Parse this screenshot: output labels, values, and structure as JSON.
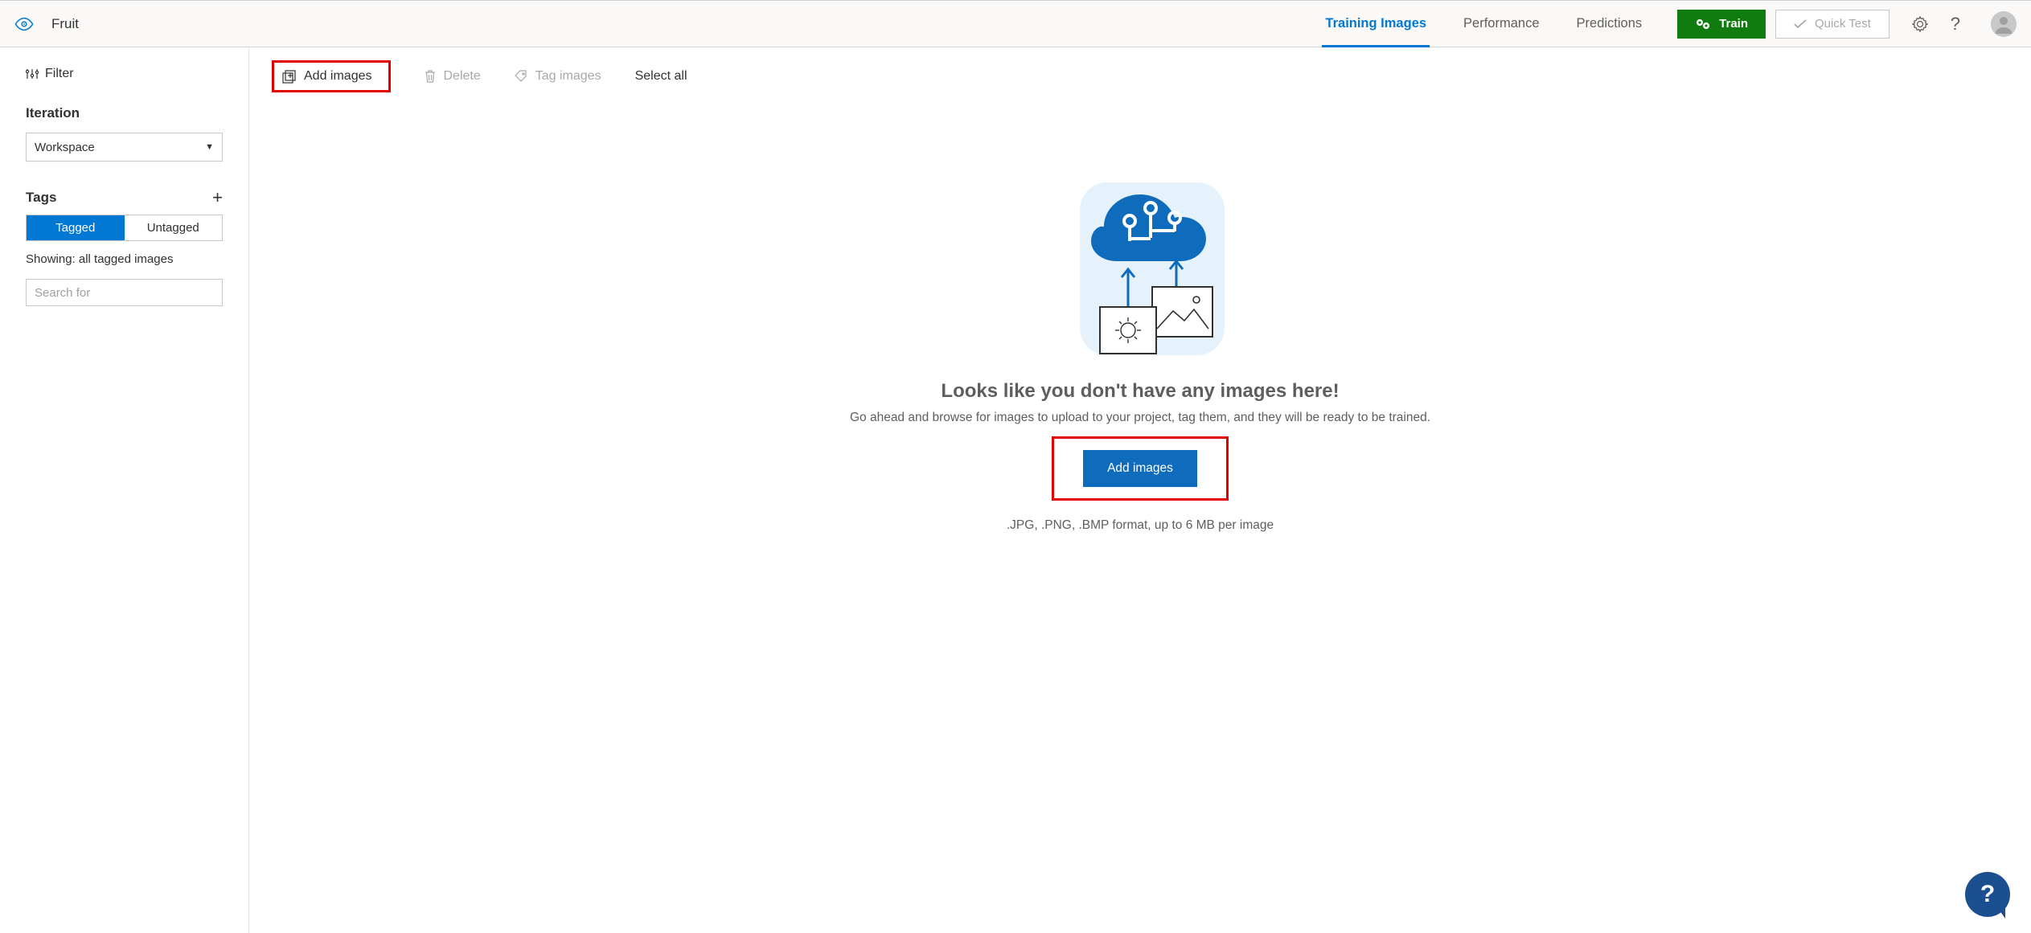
{
  "header": {
    "project_name": "Fruit",
    "tabs": {
      "training": "Training Images",
      "performance": "Performance",
      "predictions": "Predictions"
    },
    "train_label": "Train",
    "quick_label": "Quick Test"
  },
  "sidebar": {
    "filter_label": "Filter",
    "iteration_label": "Iteration",
    "iteration_value": "Workspace",
    "tags_label": "Tags",
    "toggle": {
      "tagged": "Tagged",
      "untagged": "Untagged"
    },
    "showing": "Showing: all tagged images",
    "search_placeholder": "Search for"
  },
  "toolbar": {
    "add": "Add images",
    "delete": "Delete",
    "tag": "Tag images",
    "select_all": "Select all"
  },
  "empty": {
    "title": "Looks like you don't have any images here!",
    "subtitle": "Go ahead and browse for images to upload to your project, tag them, and they will be ready to be trained.",
    "button": "Add images",
    "formats": ".JPG, .PNG, .BMP format, up to 6 MB per image"
  }
}
